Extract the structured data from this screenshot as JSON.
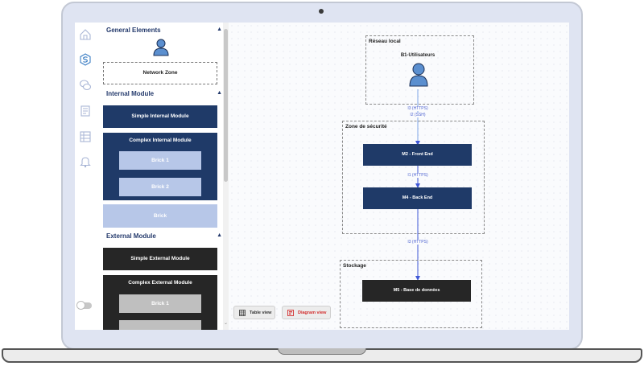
{
  "palette": {
    "sections": {
      "general": {
        "title": "General Elements",
        "network_zone": "Network Zone"
      },
      "internal": {
        "title": "Internal Module",
        "simple": "Simple Internal Module",
        "complex": "Complex Internal Module",
        "brick1": "Brick 1",
        "brick2": "Brick 2",
        "brick": "Brick"
      },
      "external": {
        "title": "External Module",
        "simple": "Simple External Module",
        "complex": "Complex External Module",
        "brick1": "Brick 1"
      }
    }
  },
  "diagram": {
    "zones": {
      "local": "Réseau local",
      "security": "Zone de sécurité",
      "storage": "Stockage"
    },
    "nodes": {
      "users": "B1-Utilisateurs",
      "front": "M2 - Front End",
      "back": "M4 - Back End",
      "db": "M5 - Base de données"
    },
    "edges": {
      "e1a": "I3 (HTTPS)",
      "e1b": "I2 (SSH)",
      "e2": "I1 (HTTPS)",
      "e3": "I3 (HTTPS)"
    }
  },
  "view_buttons": {
    "table": "Table view",
    "diagram": "Diagram view"
  },
  "colors": {
    "internal": "#1f3a68",
    "internal_light": "#b7c7e8",
    "external": "#262626",
    "external_light": "#bfbfbf",
    "accent_red": "#d32f2f",
    "edge": "#3f57d6"
  }
}
